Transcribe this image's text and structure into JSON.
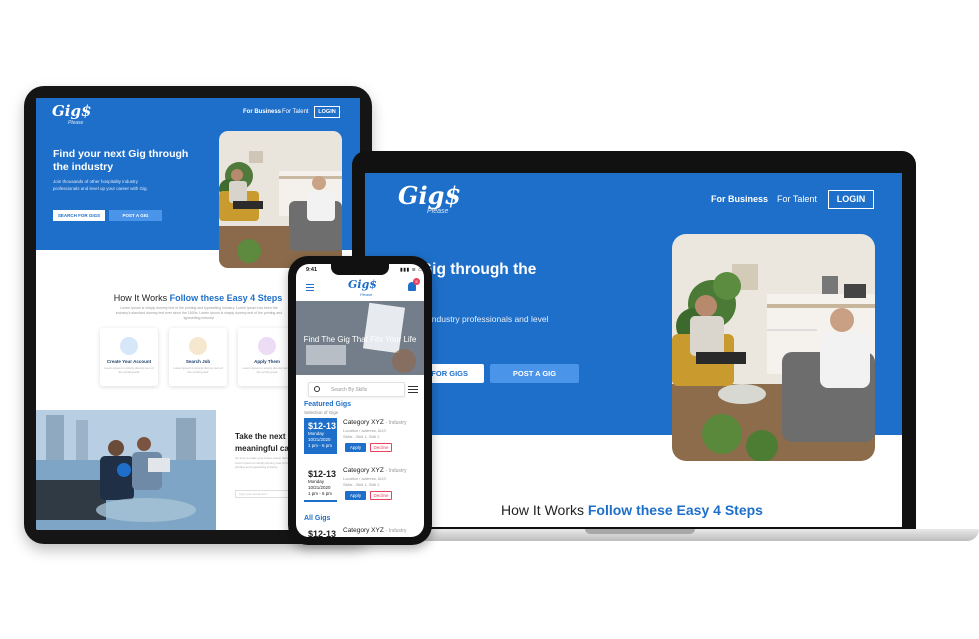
{
  "tablet": {
    "logo": "Gig$",
    "logo_sub": "Please",
    "nav": [
      "For Business",
      "For Talent"
    ],
    "login": "LOGIN",
    "headline": "Find your next Gig through the industry",
    "subtext": "Join thousands of other hospitality industry professionals and level up your career with Gig.",
    "btn_search": "SEARCH FOR GIGS",
    "btn_post": "POST A GIG",
    "how_prefix": "How It Works",
    "how_emph": "Follow these Easy 4 Steps",
    "how_text": "Lorem Ipsum is simply dummy text of the printing and typesetting industry. Lorem Ipsum has been the industry's standard dummy text ever since the 1500s. Lorem Ipsum is simply dummy text of the printing and typesetting industry.",
    "steps": [
      {
        "title": "Create Your Account",
        "text": "Lorem Ipsum is simply dummy text of the printing and"
      },
      {
        "title": "Search Job",
        "text": "Lorem Ipsum is simply dummy text of the printing and"
      },
      {
        "title": "Apply Them",
        "text": "Lorem Ipsum is simply dummy text of the printing and"
      }
    ],
    "take_title": "Take the next step into a meaningful career",
    "take_text": "It's time to make your future career decision. Lorem Ipsum is simply dummy text of the printing and typesetting industry.",
    "take_input": "Type your email here"
  },
  "laptop": {
    "logo": "Gig$",
    "logo_sub": "Please",
    "nav": [
      "For Business",
      "For Talent"
    ],
    "login": "LOGIN",
    "headline": "Find your next Gig through the industry",
    "subtext": "Join thousands of other hospitality industry professionals and level up your career with",
    "btn_search": "SEARCH FOR GIGS",
    "btn_post": "POST A GIG",
    "how_prefix": "How It Works",
    "how_emph": "Follow these Easy 4 Steps"
  },
  "phone": {
    "time": "9:41",
    "status": "▮▮▮ ≋ ▭",
    "logo": "Gig$",
    "logo_sub": "Please",
    "badge": "5",
    "banner": "Find The Gig That Fits Your Life",
    "search_placeholder": "Search By Skills",
    "featured_title": "Featured Gigs",
    "featured_sub": "Selection of Gigs",
    "jobs": [
      {
        "price": "$12-13",
        "day": "Monday",
        "date": "10/21/2020",
        "hours": "1 pm - 6 pm",
        "category": "Category XYZ",
        "industry": "- Industry",
        "location": "Location / address, AUS",
        "skills": "Skills - Skill 1, Skill 2",
        "apply": "Apply",
        "decline": "Decline"
      },
      {
        "price": "$12-13",
        "day": "Monday",
        "date": "10/21/2020",
        "hours": "1 pm - 6 pm",
        "category": "Category XYZ",
        "industry": "- Industry",
        "location": "Location / address, AUS",
        "skills": "Skills - Skill 1, Skill 2",
        "apply": "Apply",
        "decline": "Decline"
      },
      {
        "price": "$12-13",
        "category": "Category XYZ",
        "industry": "- Industry"
      }
    ],
    "all_gigs": "All Gigs"
  },
  "colors": {
    "brand_blue": "#1e6fc9",
    "accent_blue": "#4a94ea",
    "decline_red": "#e8425c"
  }
}
